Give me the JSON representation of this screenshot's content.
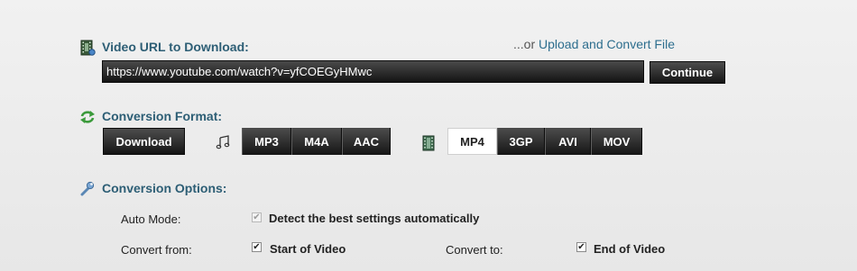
{
  "video_url": {
    "label": "Video URL to Download:",
    "value": "https://www.youtube.com/watch?v=yfCOEGyHMwc",
    "alt_prefix": "...or",
    "alt_link": "Upload and Convert File",
    "continue_label": "Continue"
  },
  "conversion_format": {
    "label": "Conversion Format:",
    "download_label": "Download",
    "audio_formats": [
      "MP3",
      "M4A",
      "AAC"
    ],
    "video_formats": [
      "MP4",
      "3GP",
      "AVI",
      "MOV"
    ],
    "selected": "MP4"
  },
  "conversion_options": {
    "label": "Conversion Options:",
    "auto_mode_label": "Auto Mode:",
    "auto_mode_text": "Detect the best settings automatically",
    "auto_mode_checked": true,
    "convert_from_label": "Convert from:",
    "convert_from_text": "Start of Video",
    "convert_from_checked": true,
    "convert_to_label": "Convert to:",
    "convert_to_text": "End of Video",
    "convert_to_checked": true
  },
  "colors": {
    "section_label": "#2d5e75",
    "link": "#2d6e8e",
    "button_dark": "#1a1a1a",
    "selected_format": "#ffffff"
  },
  "icons": [
    "film-icon",
    "refresh-icon",
    "music-note-icon",
    "film-strip-icon",
    "wrench-icon"
  ]
}
